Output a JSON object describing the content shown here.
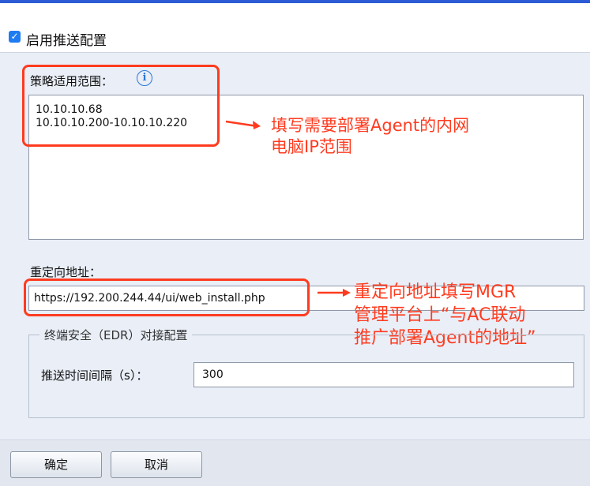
{
  "header": {
    "enable_push_label": "启用推送配置",
    "enable_push_checked": true
  },
  "policy": {
    "label": "策略适用范围：",
    "info_icon": "info-icon",
    "ip_lines": [
      "10.10.10.68",
      "10.10.10.200-10.10.10.220"
    ]
  },
  "redirect": {
    "label": "重定向地址：",
    "value": "https://192.200.244.44/ui/web_install.php"
  },
  "edr": {
    "legend": "终端安全（EDR）对接配置",
    "interval_label": "推送时间间隔（s）：",
    "interval_value": "300"
  },
  "annotations": {
    "note1_line1": "填写需要部署Agent的内网",
    "note1_line2": "电脑IP范围",
    "note2_line1": "重定向地址填写MGR",
    "note2_line2": "管理平台上“与AC联动",
    "note2_line3": "推广部署Agent的地址”",
    "color": "#ff3b1f"
  },
  "footer": {
    "confirm_label": "确定",
    "cancel_label": "取消"
  },
  "colors": {
    "accent": "#1e7cf2",
    "topbar": "#2d5bd6"
  }
}
